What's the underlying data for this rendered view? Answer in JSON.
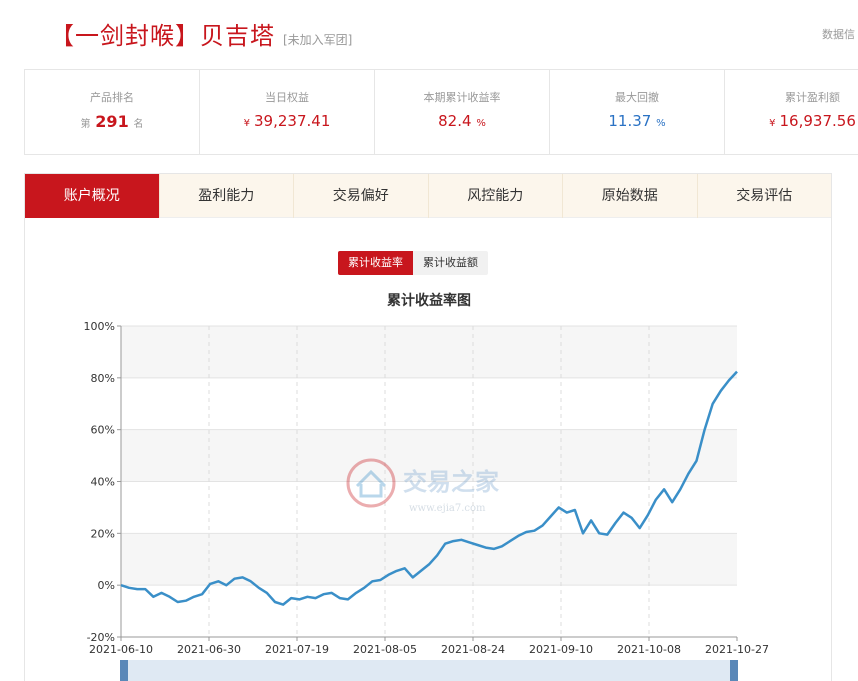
{
  "header": {
    "title": "【一剑封喉】贝吉塔",
    "subtitle": "[未加入军团]",
    "data_link": "数据信"
  },
  "stats": {
    "rank": {
      "label": "产品排名",
      "prefix": "第",
      "value": "291",
      "suffix": "名"
    },
    "equity": {
      "label": "当日权益",
      "currency": "¥",
      "value": "39,237.41"
    },
    "return_rate": {
      "label": "本期累计收益率",
      "value": "82.4",
      "unit": "%"
    },
    "max_drawdown": {
      "label": "最大回撤",
      "value": "11.37",
      "unit": "%"
    },
    "profit": {
      "label": "累计盈利额",
      "currency": "¥",
      "value": "16,937.56"
    }
  },
  "tabs": [
    {
      "label": "账户概况",
      "active": true
    },
    {
      "label": "盈利能力",
      "active": false
    },
    {
      "label": "交易偏好",
      "active": false
    },
    {
      "label": "风控能力",
      "active": false
    },
    {
      "label": "原始数据",
      "active": false
    },
    {
      "label": "交易评估",
      "active": false
    }
  ],
  "toggle": {
    "active_label": "累计收益率",
    "inactive_label": "累计收益额"
  },
  "watermark": {
    "name": "交易之家",
    "url": "www.ejia7.com"
  },
  "colors": {
    "accent": "#c8161d",
    "line": "#3a8fc8",
    "blue_value": "#2a72c4",
    "tab_bg": "#fcf6ec"
  },
  "chart_data": {
    "type": "line",
    "title": "累计收益率图",
    "ylim": [
      -20,
      100
    ],
    "yticks": [
      "100%",
      "80%",
      "60%",
      "40%",
      "20%",
      "0%",
      "-20%"
    ],
    "ytick_values": [
      100,
      80,
      60,
      40,
      20,
      0,
      -20
    ],
    "xticks": [
      "2021-06-10",
      "2021-06-30",
      "2021-07-19",
      "2021-08-05",
      "2021-08-24",
      "2021-09-10",
      "2021-10-08",
      "2021-10-27"
    ],
    "grid": true,
    "series": [
      {
        "values": [
          0.0,
          -1.0,
          -1.5,
          -1.5,
          -4.5,
          -3.0,
          -4.5,
          -6.5,
          -6.0,
          -4.5,
          -3.5,
          0.5,
          1.5,
          0.0,
          2.5,
          3.0,
          1.5,
          -1.0,
          -3.0,
          -6.5,
          -7.5,
          -5.0,
          -5.5,
          -4.5,
          -5.0,
          -3.5,
          -3.0,
          -5.0,
          -5.5,
          -3.0,
          -1.0,
          1.5,
          2.0,
          4.0,
          5.5,
          6.5,
          3.0,
          5.5,
          8.0,
          11.5,
          16.0,
          17.0,
          17.5,
          16.5,
          15.5,
          14.5,
          14.0,
          15.0,
          17.0,
          19.0,
          20.5,
          21.0,
          23.0,
          26.5,
          30.0,
          28.0,
          29.0,
          20.0,
          25.0,
          20.0,
          19.5,
          24.0,
          28.0,
          26.0,
          22.0,
          27.0,
          33.0,
          37.0,
          32.0,
          37.0,
          43.0,
          48.0,
          60.0,
          70.0,
          75.0,
          79.0,
          82.4
        ]
      }
    ]
  }
}
